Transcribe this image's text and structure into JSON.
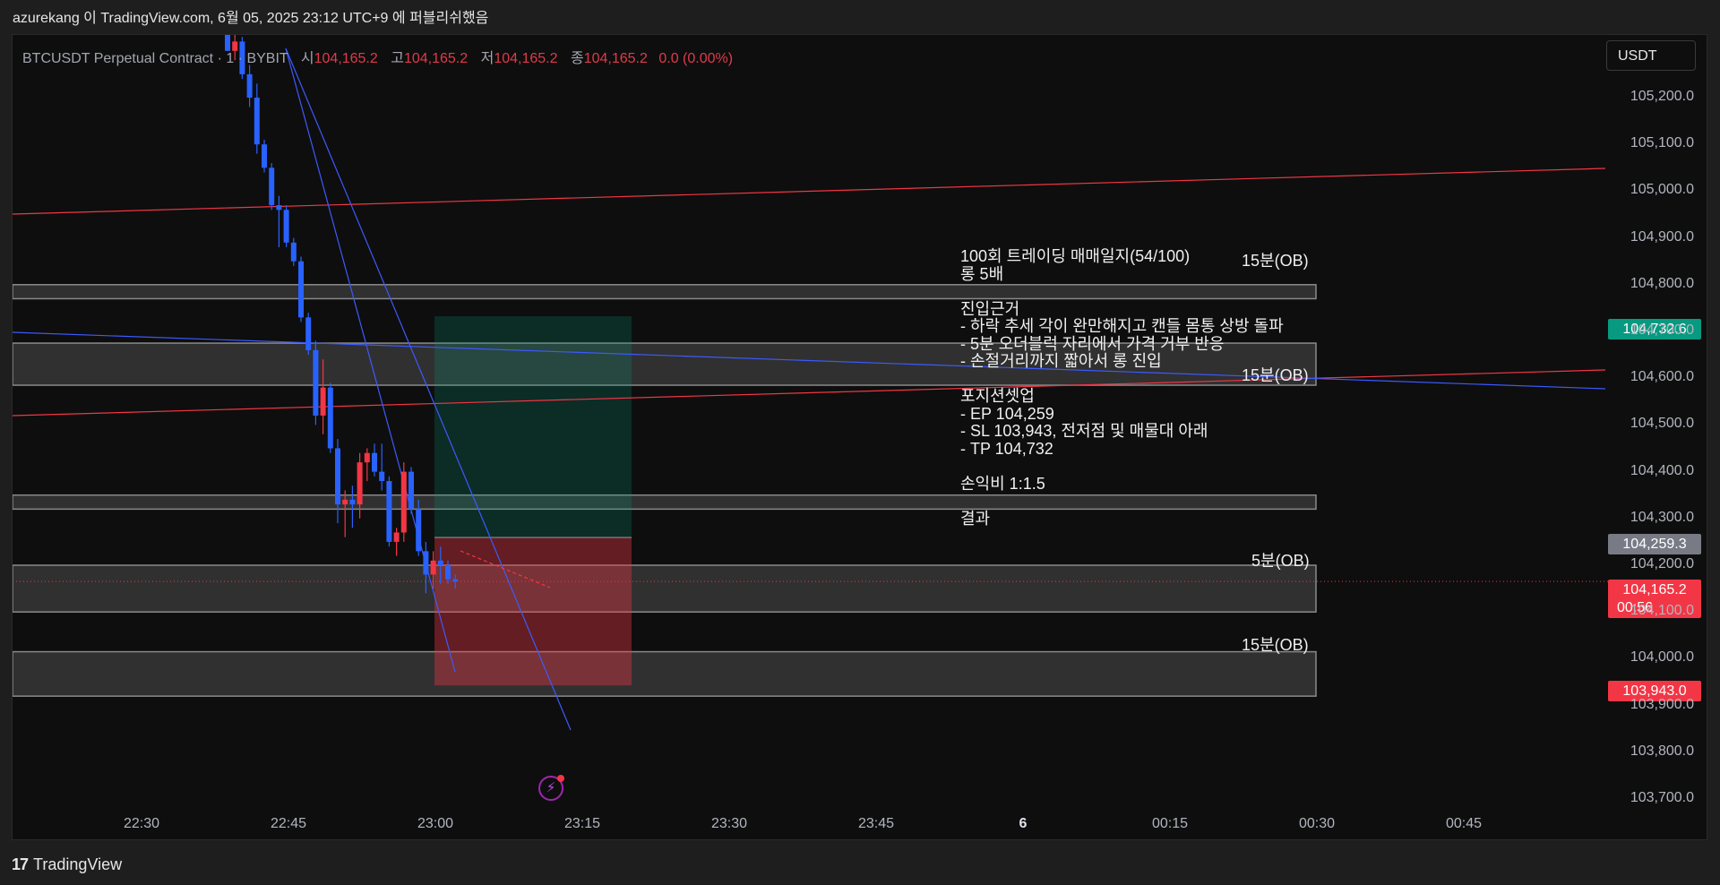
{
  "header": {
    "publish_text": "azurekang 이 TradingView.com, 6월 05, 2025 23:12 UTC+9 에 퍼블리쉬했음"
  },
  "legend": {
    "symbol": "BTCUSDT Perpetual Contract · 1 · BYBIT",
    "open_label": "시",
    "open": "104,165.2",
    "high_label": "고",
    "high": "104,165.2",
    "low_label": "저",
    "low": "104,165.2",
    "close_label": "종",
    "close": "104,165.2",
    "change": "0.0 (0.00%)"
  },
  "currency": "USDT",
  "note": {
    "text": "100회 트레이딩 매매일지(54/100)\n롱 5배\n\n진입근거\n- 하락 추세 각이 완만해지고 캔들 몸통 상방 돌파\n- 5분 오더블럭 자리에서 가격 거부 반응\n- 손절거리까지 짧아서 롱 진입\n\n포지션셋업\n- EP 104,259\n- SL 103,943, 전저점 및 매물대 아래\n- TP 104,732\n\n손익비 1:1.5\n\n결과"
  },
  "ob_labels": [
    "15분(OB)",
    "15분(OB)",
    "5분(OB)",
    "15분(OB)"
  ],
  "badges": {
    "tp": "104,732.6",
    "ep": "104,259.3",
    "price": "104,165.2",
    "countdown": "00:56",
    "sl": "103,943.0"
  },
  "colors": {
    "up": "#f23645",
    "down": "#2962ff",
    "tp": "#089981",
    "sl": "#f23645",
    "ep": "#787b86",
    "zone": "#3c3c3c",
    "trend_red": "#f23645",
    "trend_blue": "#3d5afe"
  },
  "footer": {
    "logo": "17",
    "brand": "TradingView"
  },
  "chart_data": {
    "type": "candlestick",
    "timeframe": "1",
    "x_ticks": [
      "22:30",
      "22:45",
      "23:00",
      "23:15",
      "23:30",
      "23:45",
      "6",
      "00:15",
      "00:30",
      "00:45"
    ],
    "y_ticks": [
      "105,200.0",
      "105,100.0",
      "105,000.0",
      "104,900.0",
      "104,800.0",
      "104,700.0",
      "104,600.0",
      "104,500.0",
      "104,400.0",
      "104,300.0",
      "104,200.0",
      "104,100.0",
      "104,000.0",
      "103,900.0",
      "103,800.0",
      "103,700.0"
    ],
    "ylim": [
      103690,
      105280
    ],
    "candles": [
      {
        "o": 105335,
        "h": 105380,
        "l": 105300,
        "c": 105300
      },
      {
        "o": 105300,
        "h": 105340,
        "l": 105280,
        "c": 105320
      },
      {
        "o": 105320,
        "h": 105330,
        "l": 105240,
        "c": 105250
      },
      {
        "o": 105250,
        "h": 105270,
        "l": 105180,
        "c": 105200
      },
      {
        "o": 105200,
        "h": 105230,
        "l": 105080,
        "c": 105100
      },
      {
        "o": 105100,
        "h": 105110,
        "l": 105040,
        "c": 105050
      },
      {
        "o": 105050,
        "h": 105060,
        "l": 104960,
        "c": 104970
      },
      {
        "o": 104970,
        "h": 104990,
        "l": 104880,
        "c": 104960
      },
      {
        "o": 104960,
        "h": 104970,
        "l": 104880,
        "c": 104890
      },
      {
        "o": 104890,
        "h": 104900,
        "l": 104840,
        "c": 104850
      },
      {
        "o": 104850,
        "h": 104860,
        "l": 104720,
        "c": 104730
      },
      {
        "o": 104730,
        "h": 104740,
        "l": 104650,
        "c": 104660
      },
      {
        "o": 104660,
        "h": 104680,
        "l": 104500,
        "c": 104520
      },
      {
        "o": 104520,
        "h": 104640,
        "l": 104480,
        "c": 104580
      },
      {
        "o": 104580,
        "h": 104590,
        "l": 104440,
        "c": 104450
      },
      {
        "o": 104450,
        "h": 104470,
        "l": 104290,
        "c": 104330
      },
      {
        "o": 104330,
        "h": 104360,
        "l": 104260,
        "c": 104340
      },
      {
        "o": 104340,
        "h": 104370,
        "l": 104280,
        "c": 104330
      },
      {
        "o": 104330,
        "h": 104440,
        "l": 104300,
        "c": 104420
      },
      {
        "o": 104420,
        "h": 104450,
        "l": 104380,
        "c": 104440
      },
      {
        "o": 104440,
        "h": 104460,
        "l": 104390,
        "c": 104400
      },
      {
        "o": 104400,
        "h": 104460,
        "l": 104360,
        "c": 104380
      },
      {
        "o": 104380,
        "h": 104390,
        "l": 104240,
        "c": 104250
      },
      {
        "o": 104250,
        "h": 104280,
        "l": 104220,
        "c": 104270
      },
      {
        "o": 104270,
        "h": 104420,
        "l": 104250,
        "c": 104400
      },
      {
        "o": 104400,
        "h": 104410,
        "l": 104310,
        "c": 104320
      },
      {
        "o": 104320,
        "h": 104340,
        "l": 104220,
        "c": 104230
      },
      {
        "o": 104230,
        "h": 104250,
        "l": 104140,
        "c": 104180
      },
      {
        "o": 104180,
        "h": 104230,
        "l": 104150,
        "c": 104210
      },
      {
        "o": 104210,
        "h": 104240,
        "l": 104160,
        "c": 104200
      },
      {
        "o": 104200,
        "h": 104210,
        "l": 104160,
        "c": 104170
      },
      {
        "o": 104170,
        "h": 104180,
        "l": 104150,
        "c": 104165.2
      }
    ],
    "position": {
      "entry": 104259.3,
      "take_profit": 104732.6,
      "stop_loss": 103943.0
    },
    "last_price": 104165.2,
    "order_blocks": [
      {
        "top": 104800,
        "bottom": 104770,
        "label": "15분(OB)"
      },
      {
        "top": 104675,
        "bottom": 104585,
        "label": "15분(OB)"
      },
      {
        "top": 104350,
        "bottom": 104320,
        "label": ""
      },
      {
        "top": 104200,
        "bottom": 104100,
        "label": "5분(OB)"
      },
      {
        "top": 104015,
        "bottom": 103920,
        "label": "15분(OB)"
      }
    ]
  }
}
